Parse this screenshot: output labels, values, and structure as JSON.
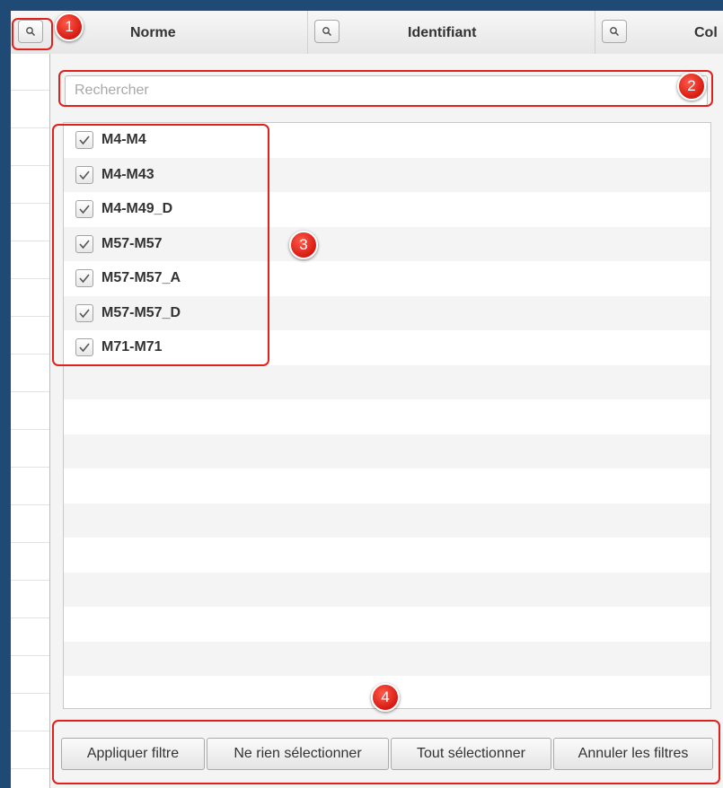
{
  "header": {
    "columns": [
      {
        "label": "Norme",
        "filter_icon": "search-icon"
      },
      {
        "label": "Identifiant",
        "filter_icon": "search-icon"
      },
      {
        "label": "Col",
        "filter_icon": "search-icon"
      }
    ]
  },
  "filter_popup": {
    "search_placeholder": "Rechercher",
    "search_value": "",
    "items": [
      {
        "label": "M4-M4",
        "checked": true
      },
      {
        "label": "M4-M43",
        "checked": true
      },
      {
        "label": "M4-M49_D",
        "checked": true
      },
      {
        "label": "M57-M57",
        "checked": true
      },
      {
        "label": "M57-M57_A",
        "checked": true
      },
      {
        "label": "M57-M57_D",
        "checked": true
      },
      {
        "label": "M71-M71",
        "checked": true
      }
    ],
    "buttons": {
      "apply": "Appliquer filtre",
      "select_none": "Ne rien sélectionner",
      "select_all": "Tout sélectionner",
      "cancel_filters": "Annuler les filtres"
    }
  },
  "annotations": {
    "badges": [
      "1",
      "2",
      "3",
      "4"
    ],
    "color": "#e0211c"
  },
  "colors": {
    "background": "#1f4a75",
    "annotation_red": "#e0211c"
  }
}
